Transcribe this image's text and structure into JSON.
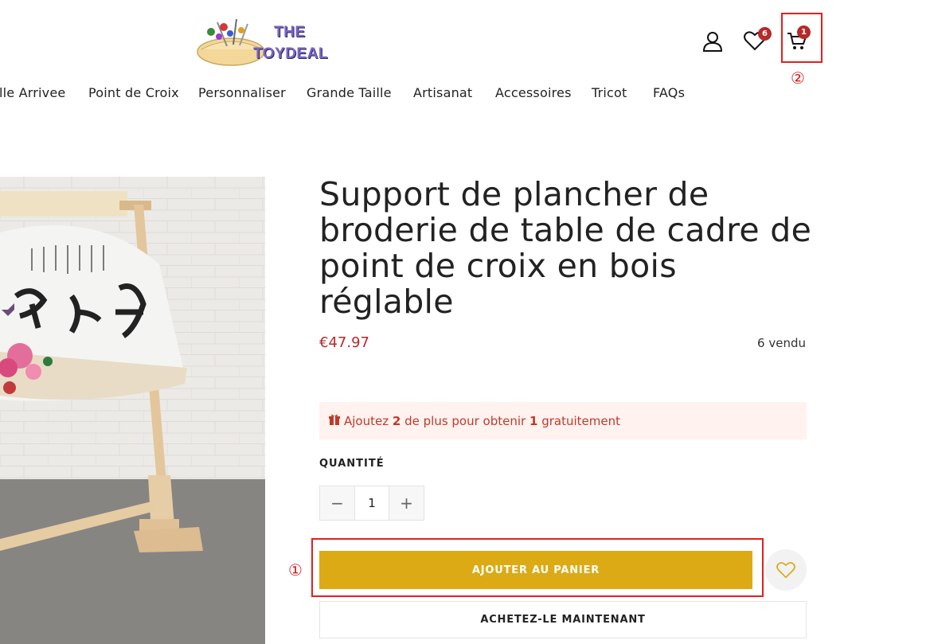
{
  "header": {
    "logo_line1": "THE",
    "logo_line2": "TOYDEAL",
    "wishlist_count": "6",
    "cart_count": "1"
  },
  "nav": {
    "items": [
      "lle Arrivee",
      "Point de Croix",
      "Personnaliser",
      "Grande Taille",
      "Artisanat",
      "Accessoires",
      "Tricot",
      "FAQs"
    ]
  },
  "product": {
    "title": "Support de plancher de broderie de table de cadre de point de croix en bois réglable",
    "price": "€47.97",
    "sold": "6 vendu",
    "promo": {
      "prefix": "Ajoutez",
      "count": "2",
      "middle": "de plus pour obtenir",
      "free_count": "1",
      "suffix": "gratuitement"
    },
    "quantity_label": "QUANTITÉ",
    "quantity_value": "1",
    "minus_symbol": "−",
    "plus_symbol": "+",
    "add_to_cart_label": "AJOUTER AU PANIER",
    "buy_now_label": "ACHETEZ-LE MAINTENANT"
  },
  "annotations": {
    "one": "①",
    "two": "②"
  },
  "colors": {
    "accent": "#dcaa15",
    "price": "#b52a2a",
    "promo_bg": "#fff2ef",
    "annotation": "#e41e1e"
  },
  "icons": [
    "user-icon",
    "heart-icon",
    "cart-icon",
    "gift-icon",
    "heart-outline-icon"
  ]
}
